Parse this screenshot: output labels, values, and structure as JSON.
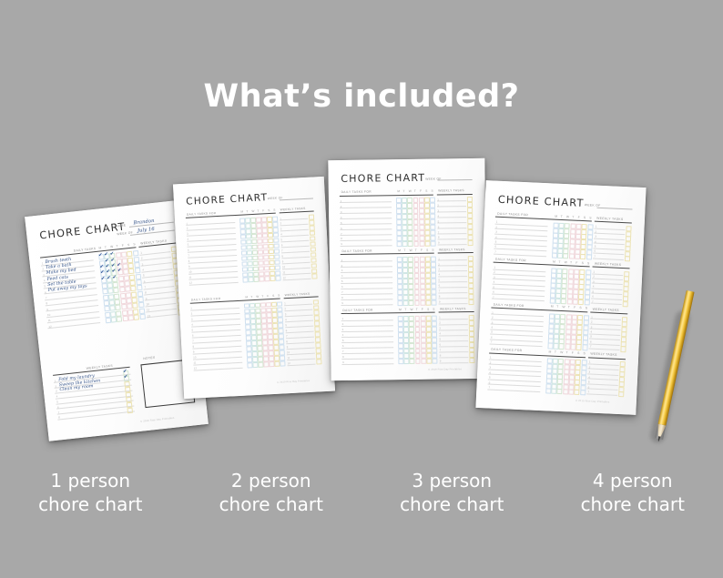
{
  "page": {
    "background_color": "#a8a8a8",
    "title": "What’s included?"
  },
  "captions": [
    {
      "line1": "1 person",
      "line2": "chore chart"
    },
    {
      "line1": "2 person",
      "line2": "chore chart"
    },
    {
      "line1": "3 person",
      "line2": "chore chart"
    },
    {
      "line1": "4 person",
      "line2": "chore chart"
    }
  ],
  "common": {
    "chart_title": "CHORE CHART",
    "label_name": "NAME",
    "label_week_of": "WEEK OF",
    "label_daily_tasks": "DAILY TASKS",
    "label_weekly_tasks": "WEEKLY TASKS",
    "label_notes": "NOTES",
    "label_daily_tasks_for": "DAILY TASKS FOR",
    "day_letters": [
      "M",
      "T",
      "W",
      "T",
      "F",
      "S",
      "S"
    ],
    "footer": "© 2019 Rise Day Printables",
    "checkmark_glyph": "✔",
    "colors": {
      "ink": "#2f4f86",
      "rule": "#4a4a4a",
      "row_line": "#dcdcdc",
      "label_gray": "#8a8a8a",
      "box_blue": "#cfe0ef",
      "box_green": "#d4e6d2",
      "box_pink": "#f0d8dc",
      "box_yellow": "#ece3b4",
      "box_teal": "#cfe6e4",
      "pencil_yellow": "#f3c53b"
    }
  },
  "sheets": [
    {
      "id": "sheet-1-person",
      "persons": 1,
      "has_notes": true,
      "filled": true,
      "name_value": "Brandon",
      "week_of_value": "July 16",
      "daily_tasks": [
        "Brush teeth",
        "Take a bath",
        "Make my bed",
        "Feed cats",
        "Set the table",
        "Put away my toys"
      ],
      "daily_checks": [
        [
          1,
          1,
          1,
          0,
          0,
          0,
          0
        ],
        [
          0,
          1,
          1,
          0,
          0,
          0,
          0
        ],
        [
          1,
          1,
          1,
          1,
          0,
          0,
          0
        ],
        [
          1,
          1,
          1,
          1,
          0,
          0,
          0
        ],
        [
          1,
          1,
          1,
          0,
          0,
          0,
          0
        ],
        [
          0,
          0,
          0,
          0,
          0,
          0,
          0
        ]
      ],
      "weekly_tasks": [
        "Fold my laundry",
        "Sweep the kitchen",
        "Clean my room"
      ],
      "weekly_checks": [
        1,
        1,
        0
      ],
      "daily_row_count": 12,
      "weekly_row_count": 8
    },
    {
      "id": "sheet-2-person",
      "persons": 2,
      "has_notes": false,
      "filled": false,
      "daily_row_count": 12,
      "weekly_row_count": 12
    },
    {
      "id": "sheet-3-person",
      "persons": 3,
      "has_notes": false,
      "filled": false,
      "daily_row_count": 9,
      "weekly_row_count": 9
    },
    {
      "id": "sheet-4-person",
      "persons": 4,
      "has_notes": false,
      "filled": false,
      "daily_row_count": 7,
      "weekly_row_count": 7
    }
  ],
  "pencil": {
    "name": "yellow-pencil",
    "body_color": "#f3c53b",
    "wood_color": "#efdfc0",
    "lead_color": "#3c3c3c"
  }
}
